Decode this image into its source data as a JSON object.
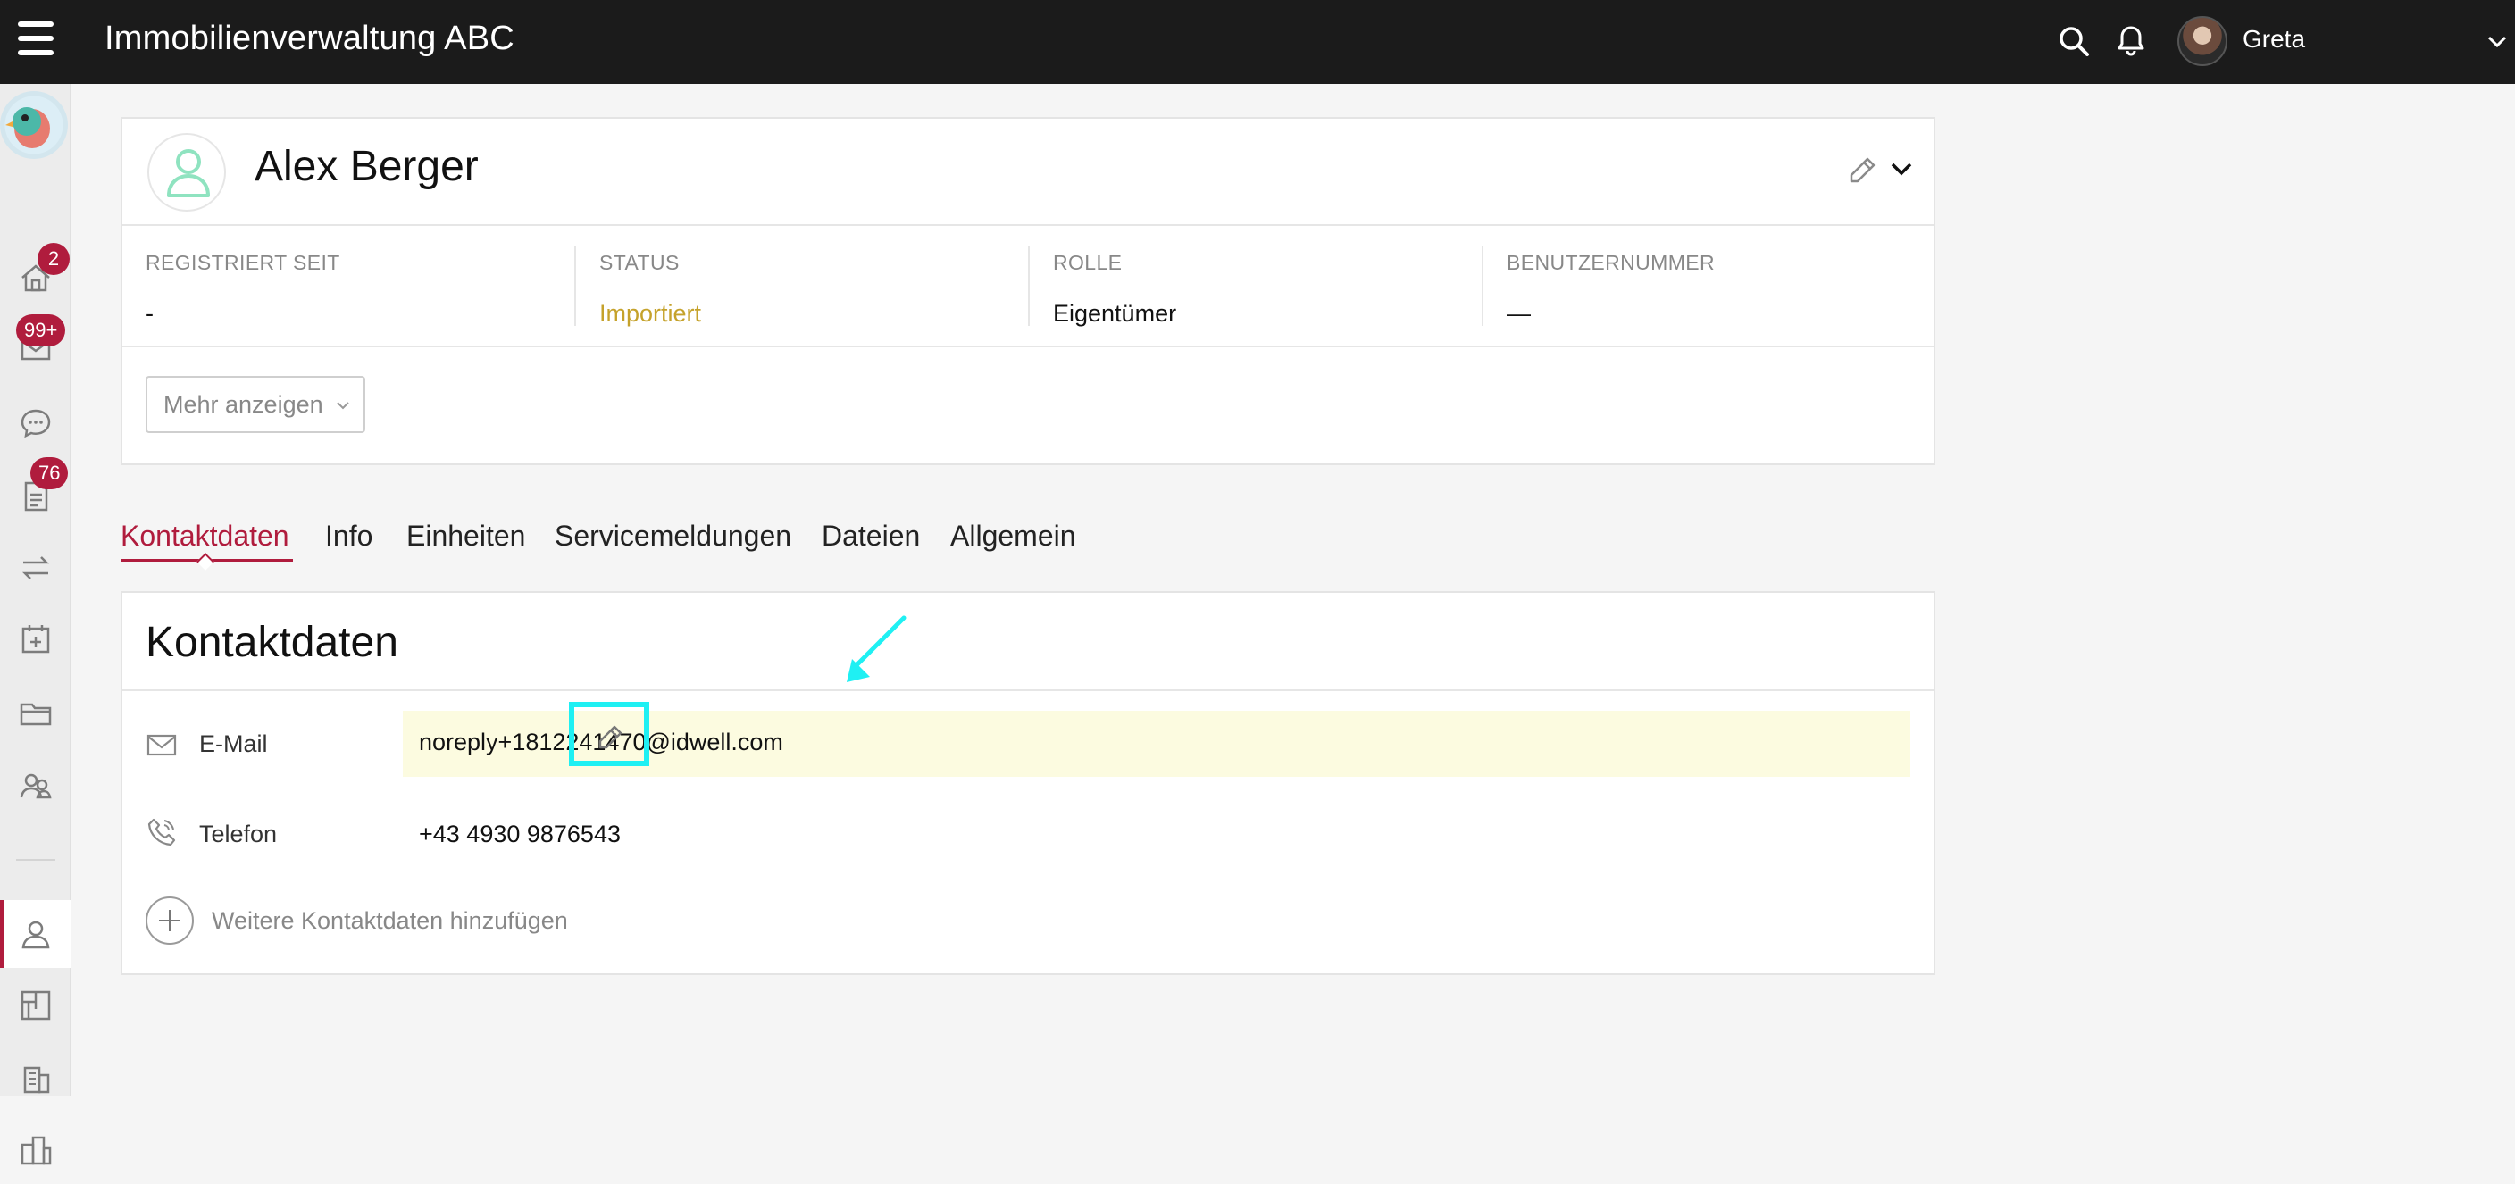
{
  "app": {
    "title": "Immobilienverwaltung ABC"
  },
  "topbar": {
    "user_name": "Greta"
  },
  "sidebar": {
    "badges": {
      "home": "2",
      "mail": "99+",
      "documents": "76"
    }
  },
  "person": {
    "name": "Alex Berger",
    "stats": [
      {
        "label": "REGISTRIERT SEIT",
        "value": "-"
      },
      {
        "label": "STATUS",
        "value": "Importiert"
      },
      {
        "label": "ROLLE",
        "value": "Eigentümer"
      },
      {
        "label": "BENUTZERNUMMER",
        "value": "—"
      }
    ],
    "more_button": "Mehr anzeigen"
  },
  "tabs": [
    "Kontaktdaten",
    "Info",
    "Einheiten",
    "Servicemeldungen",
    "Dateien",
    "Allgemein"
  ],
  "active_tab": "Kontaktdaten",
  "contact": {
    "title": "Kontaktdaten",
    "email_label": "E-Mail",
    "email_value": "noreply+1812241470@idwell.com",
    "phone_label": "Telefon",
    "phone_value": "+43 4930 9876543",
    "add_label": "Weitere Kontaktdaten hinzufügen"
  },
  "icons": {
    "menu": "hamburger-icon",
    "search": "search-icon",
    "bell": "bell-icon",
    "user_chevron": "chevron-down-icon",
    "edit": "pencil-icon",
    "mail": "mail-icon",
    "phone": "phone-icon",
    "add": "plus-circle-icon"
  },
  "colors": {
    "accent": "#b01c3d",
    "status": "#c5a22b",
    "highlight": "#fcfbe0",
    "annotation": "#1ff0f3",
    "topbar": "#1b1b1b"
  }
}
